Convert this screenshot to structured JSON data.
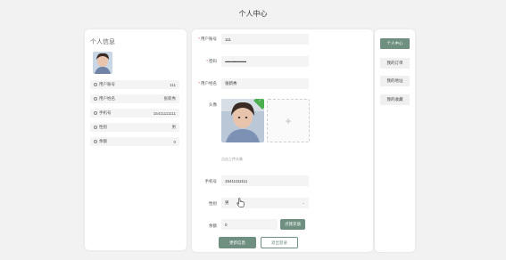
{
  "page": {
    "title": "个人中心"
  },
  "profile_card": {
    "title": "个人信息",
    "rows": [
      {
        "label": "用户账号",
        "value": "111"
      },
      {
        "label": "用户姓名",
        "value": "张新秀"
      },
      {
        "label": "手机号",
        "value": "15411111111"
      },
      {
        "label": "性别",
        "value": "男"
      },
      {
        "label": "余额",
        "value": "0"
      }
    ]
  },
  "form": {
    "account_label": "用户账号",
    "account_value": "111",
    "password_label": "密码",
    "password_value": "••••••••••••••••••••••",
    "name_label": "用户姓名",
    "name_value": "张新秀",
    "avatar_label": "头像",
    "upload_plus": "+",
    "upload_hint": "点击上传头像",
    "phone_label": "手机号",
    "phone_value": "15411111111",
    "gender_label": "性别",
    "gender_value": "男",
    "balance_label": "余额",
    "balance_value": "0",
    "recharge_button": "点我充值",
    "update_button": "更新信息",
    "logout_button": "退出登录"
  },
  "side_menu": {
    "items": [
      {
        "label": "个人中心"
      },
      {
        "label": "我的订单"
      },
      {
        "label": "我的地址"
      },
      {
        "label": "我的收藏"
      }
    ]
  },
  "colors": {
    "accent": "#6f8f80",
    "badge": "#4caf50",
    "required": "#e55555"
  }
}
